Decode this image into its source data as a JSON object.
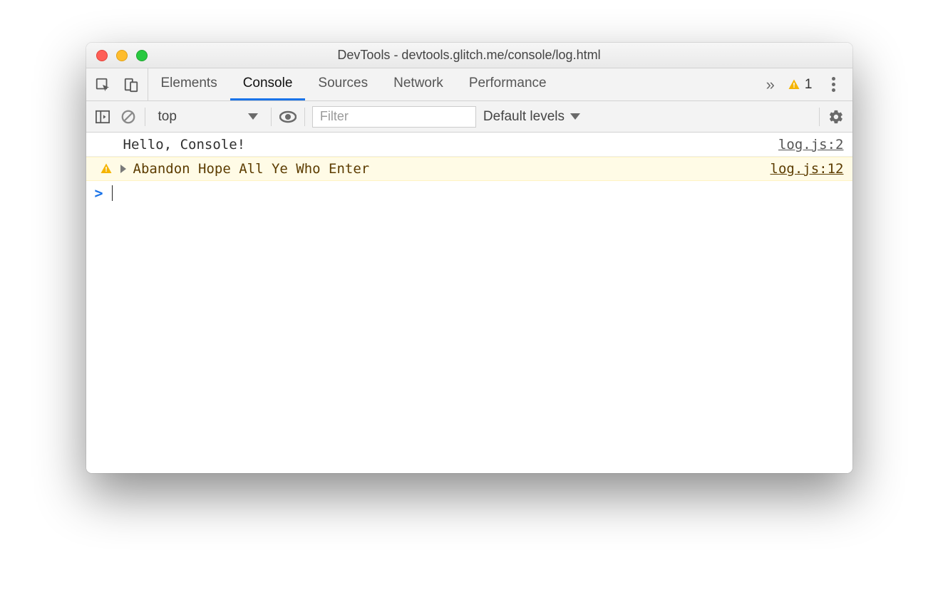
{
  "window": {
    "title": "DevTools - devtools.glitch.me/console/log.html"
  },
  "tabs": {
    "items": [
      "Elements",
      "Console",
      "Sources",
      "Network",
      "Performance"
    ],
    "active": "Console",
    "overflow_glyph": "»",
    "warning_count": "1"
  },
  "toolbar": {
    "context": "top",
    "filter_placeholder": "Filter",
    "levels_label": "Default levels"
  },
  "console": {
    "rows": [
      {
        "type": "log",
        "message": "Hello, Console!",
        "source": "log.js:2"
      },
      {
        "type": "warn",
        "message": "Abandon Hope All Ye Who Enter",
        "source": "log.js:12"
      }
    ],
    "prompt": ">"
  }
}
